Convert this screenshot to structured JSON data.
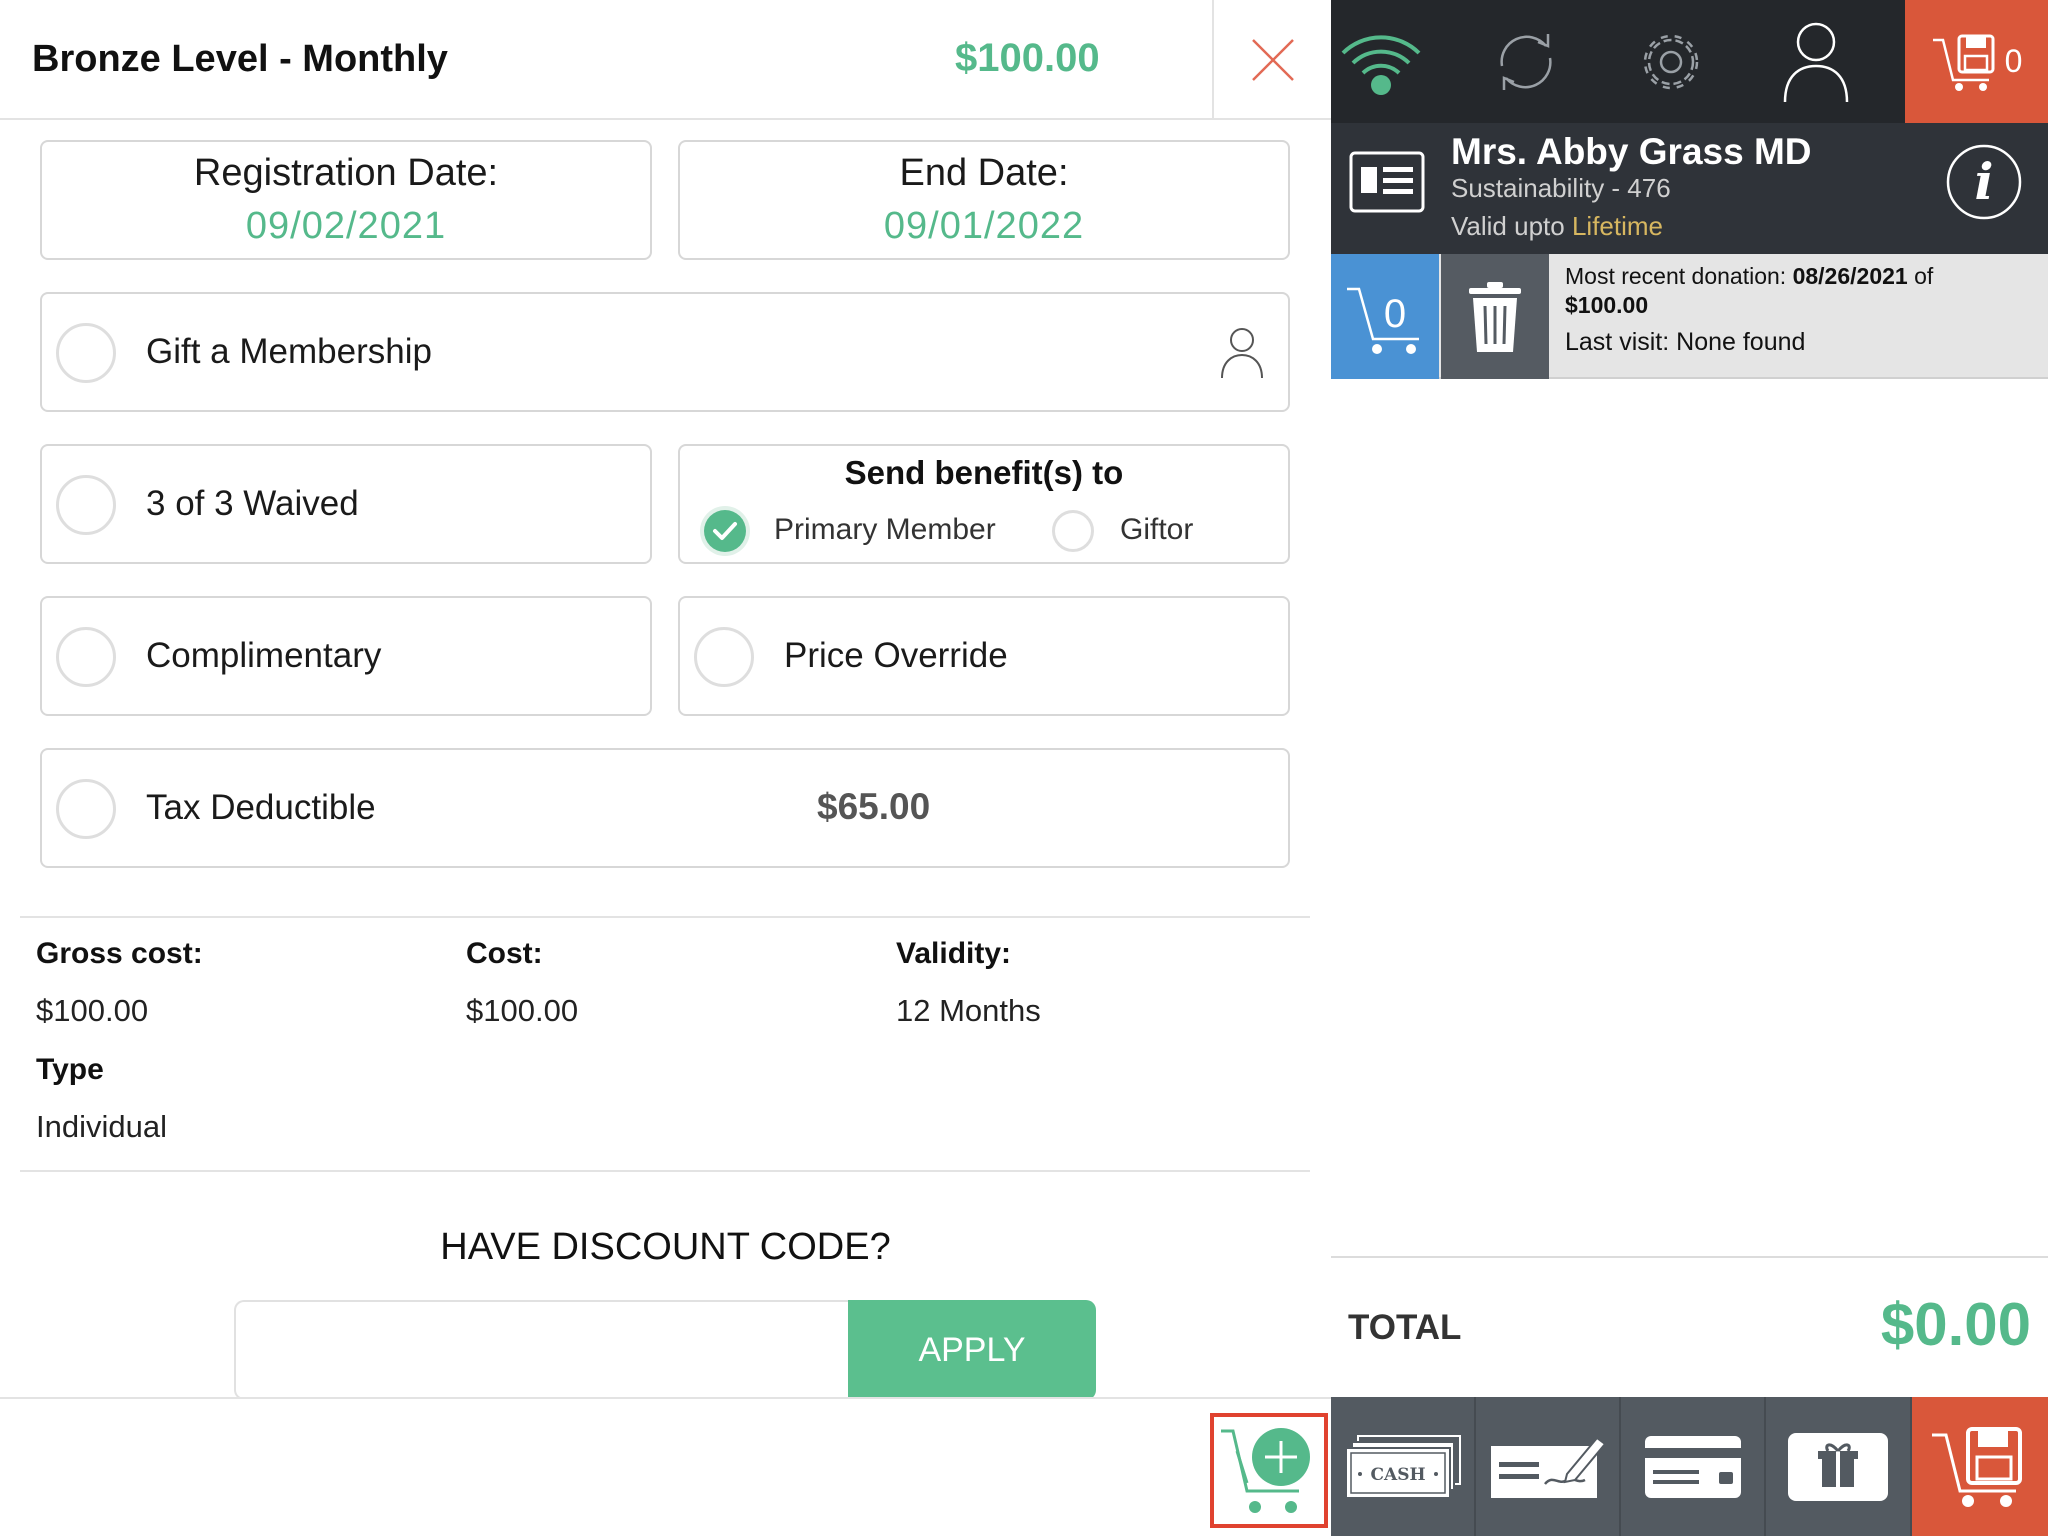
{
  "header": {
    "title": "Bronze Level - Monthly",
    "price": "$100.00"
  },
  "dates": {
    "registration_label": "Registration Date:",
    "registration_value": "09/02/2021",
    "end_label": "End Date:",
    "end_value": "09/01/2022"
  },
  "options": {
    "gift_label": "Gift a Membership",
    "waived_label": "3 of 3 Waived",
    "complimentary_label": "Complimentary",
    "price_override_label": "Price Override",
    "tax_label": "Tax Deductible",
    "tax_amount": "$65.00"
  },
  "benefits": {
    "title": "Send benefit(s) to",
    "primary_label": "Primary Member",
    "primary_selected": true,
    "giftor_label": "Giftor"
  },
  "details": {
    "gross_label": "Gross cost:",
    "gross_value": "$100.00",
    "cost_label": "Cost:",
    "cost_value": "$100.00",
    "validity_label": "Validity:",
    "validity_value": "12 Months",
    "type_label": "Type",
    "type_value": "Individual"
  },
  "discount": {
    "title": "HAVE DISCOUNT CODE?",
    "input_value": "",
    "apply_label": "APPLY"
  },
  "topbar": {
    "cart_count": "0",
    "icons": [
      "wifi-icon",
      "sync-icon",
      "gear-icon",
      "user-icon",
      "cart-save-icon"
    ]
  },
  "member": {
    "name": "Mrs. Abby Grass MD",
    "subtitle": "Sustainability - 476",
    "valid_prefix": "Valid upto",
    "valid_value": "Lifetime"
  },
  "quick": {
    "cart_count": "0",
    "recent_prefix": "Most recent donation:",
    "recent_date": "08/26/2021",
    "recent_of": "of",
    "recent_amount": "$100.00",
    "last_visit": "Last visit: None found"
  },
  "total": {
    "label": "TOTAL",
    "value": "$0.00"
  },
  "payment": {
    "cash_label": "CASH",
    "icons": [
      "cash-icon",
      "check-icon",
      "credit-card-icon",
      "gift-card-icon",
      "cart-save-icon"
    ]
  },
  "colors": {
    "accent_green": "#55b98b",
    "dark_bar": "#24272b",
    "member_bar": "#2f3339",
    "orange": "#d9573a",
    "blue": "#4a92d4",
    "gold": "#d7b760"
  }
}
